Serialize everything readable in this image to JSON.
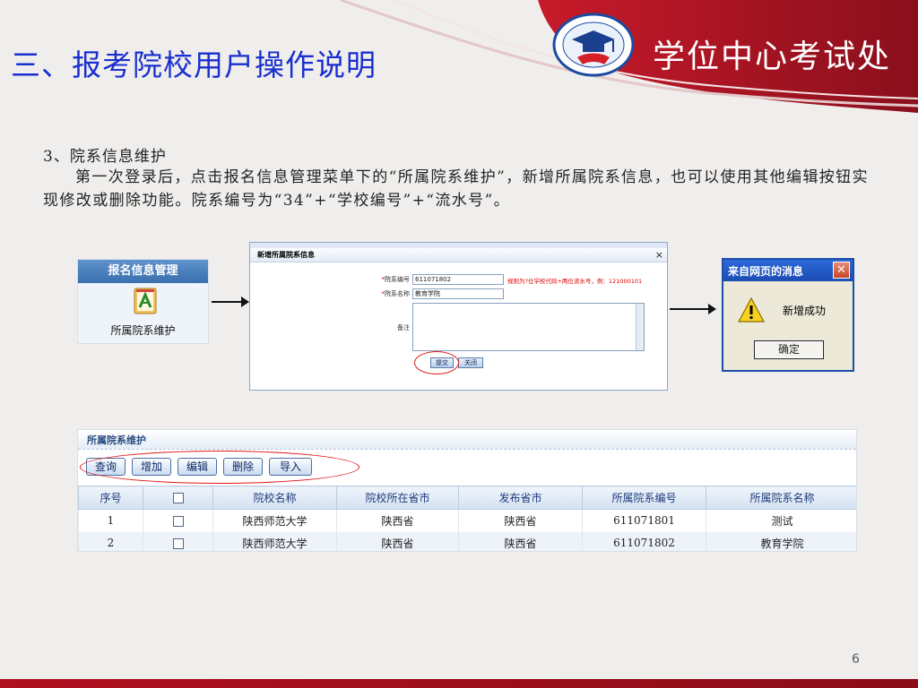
{
  "slide": {
    "title": "三、报考院校用户操作说明",
    "org_name": "学位中心考试处",
    "page_number": "6"
  },
  "content": {
    "section_heading": "3、院系信息维护",
    "paragraph": "第一次登录后，点击报名信息管理菜单下的“所属院系维护”，新增所属院系信息，也可以使用其他编辑按钮实现修改或删除功能。院系编号为“34”+“学校编号”+“流水号”。"
  },
  "menu_panel": {
    "header": "报名信息管理",
    "item_label": "所属院系维护",
    "icon": "document-edit-icon"
  },
  "dialog": {
    "title": "新增所属院系信息",
    "close_glyph": "×",
    "fields": {
      "code_label": "院系编号",
      "code_value": "611071802",
      "code_hint": "规则为?位学校代码+两位流水号，例：121000101",
      "name_label": "院系名称",
      "name_value": "教育学院",
      "remark_label": "备注",
      "required_mark": "*"
    },
    "submit_label": "提交",
    "close_label": "关闭"
  },
  "message_box": {
    "title": "来自网页的消息",
    "close_glyph": "✕",
    "icon": "warning-icon",
    "text": "新增成功",
    "ok_label": "确定"
  },
  "list_panel": {
    "title": "所属院系维护",
    "toolbar": [
      "查询",
      "增加",
      "编辑",
      "删除",
      "导入"
    ],
    "columns": [
      "序号",
      "",
      "院校名称",
      "院校所在省市",
      "发布省市",
      "所属院系编号",
      "所属院系名称"
    ],
    "rows": [
      [
        "1",
        "",
        "陕西师范大学",
        "陕西省",
        "陕西省",
        "611071801",
        "测试"
      ],
      [
        "2",
        "",
        "陕西师范大学",
        "陕西省",
        "陕西省",
        "611071802",
        "教育学院"
      ]
    ]
  },
  "colors": {
    "title_blue": "#1a2fd0",
    "header_red": "#9c1422",
    "highlight_red": "#e01818"
  }
}
